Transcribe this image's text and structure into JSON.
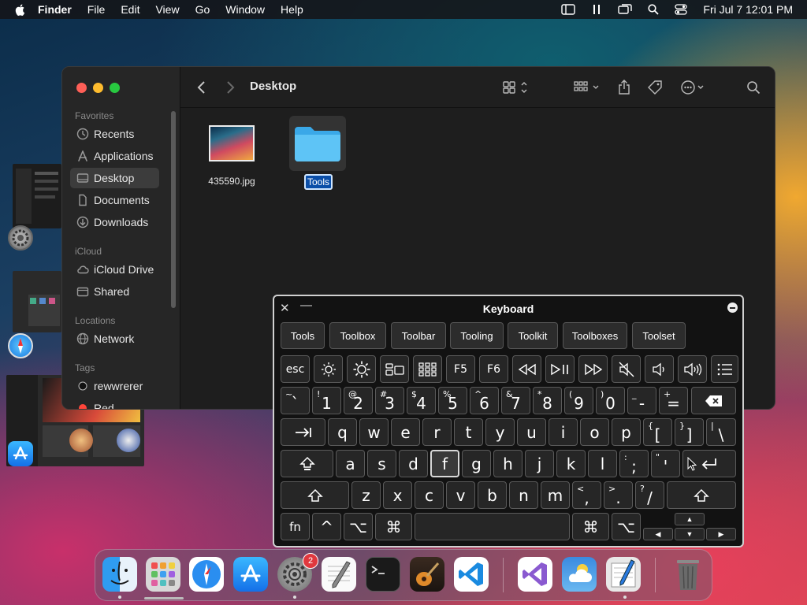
{
  "menubar": {
    "app_name": "Finder",
    "items": [
      "File",
      "Edit",
      "View",
      "Go",
      "Window",
      "Help"
    ],
    "clock": "Fri Jul 7  12:01 PM",
    "status_icons": [
      "sidebar-icon",
      "pause-icon",
      "screen-mirror-icon",
      "search-icon",
      "control-center-icon"
    ]
  },
  "finder": {
    "title": "Desktop",
    "sidebar": {
      "favorites_label": "Favorites",
      "favorites": [
        "Recents",
        "Applications",
        "Desktop",
        "Documents",
        "Downloads"
      ],
      "icloud_label": "iCloud",
      "icloud": [
        "iCloud Drive",
        "Shared"
      ],
      "locations_label": "Locations",
      "locations": [
        "Network"
      ],
      "tags_label": "Tags",
      "tags": [
        "rewwrerer",
        "Red"
      ],
      "selected": "Desktop"
    },
    "files": [
      {
        "name": "435590.jpg",
        "type": "image"
      },
      {
        "name": "Tools",
        "type": "folder",
        "editing": true
      }
    ]
  },
  "keyboard": {
    "title": "Keyboard",
    "suggestions": [
      "Tools",
      "Toolbox",
      "Toolbar",
      "Tooling",
      "Toolkit",
      "Toolboxes",
      "Toolset"
    ],
    "function_row": [
      "esc",
      "brightness-down-icon",
      "brightness-up-icon",
      "mission-control-icon",
      "launchpad-icon",
      "F5",
      "F6",
      "rewind-icon",
      "play-pause-icon",
      "fast-forward-icon",
      "mute-icon",
      "volume-down-icon",
      "volume-up-icon",
      "list-icon"
    ],
    "row1": [
      {
        "m": "`",
        "s": "~"
      },
      {
        "m": "1",
        "s": "!"
      },
      {
        "m": "2",
        "s": "@"
      },
      {
        "m": "3",
        "s": "#"
      },
      {
        "m": "4",
        "s": "$"
      },
      {
        "m": "5",
        "s": "%"
      },
      {
        "m": "6",
        "s": "^"
      },
      {
        "m": "7",
        "s": "&"
      },
      {
        "m": "8",
        "s": "*"
      },
      {
        "m": "9",
        "s": "("
      },
      {
        "m": "0",
        "s": ")"
      },
      {
        "m": "-",
        "s": "_"
      },
      {
        "m": "=",
        "s": "+"
      }
    ],
    "row2": [
      {
        "m": "q"
      },
      {
        "m": "w"
      },
      {
        "m": "e"
      },
      {
        "m": "r"
      },
      {
        "m": "t"
      },
      {
        "m": "y"
      },
      {
        "m": "u"
      },
      {
        "m": "i"
      },
      {
        "m": "o"
      },
      {
        "m": "p"
      },
      {
        "m": "[",
        "s": "{"
      },
      {
        "m": "]",
        "s": "}"
      },
      {
        "m": "\\",
        "s": "|"
      }
    ],
    "row3": [
      {
        "m": "a"
      },
      {
        "m": "s"
      },
      {
        "m": "d"
      },
      {
        "m": "f"
      },
      {
        "m": "g"
      },
      {
        "m": "h"
      },
      {
        "m": "j"
      },
      {
        "m": "k"
      },
      {
        "m": "l"
      },
      {
        "m": ";",
        "s": ":"
      },
      {
        "m": "'",
        "s": "\""
      }
    ],
    "row4": [
      {
        "m": "z"
      },
      {
        "m": "x"
      },
      {
        "m": "c"
      },
      {
        "m": "v"
      },
      {
        "m": "b"
      },
      {
        "m": "n"
      },
      {
        "m": "m"
      },
      {
        "m": ",",
        "s": "<"
      },
      {
        "m": ".",
        "s": ">"
      },
      {
        "m": "/",
        "s": "?"
      }
    ],
    "highlighted_key": "f",
    "bottom": {
      "fn": "fn",
      "ctrl": "^",
      "opt": "⌥",
      "cmd": "⌘",
      "cmd_r": "⌘",
      "opt_r": "⌥"
    },
    "arrows": {
      "up": "▲",
      "left": "◀",
      "down": "▼",
      "right": "▶"
    }
  },
  "dock": {
    "apps": [
      "Finder",
      "Launchpad",
      "Safari",
      "App Store",
      "System Settings",
      "TextEdit",
      "Terminal",
      "GarageBand",
      "Visual Studio Code",
      "Visual Studio",
      "Weather",
      "Script Editor",
      "Trash"
    ],
    "badge": "2"
  }
}
